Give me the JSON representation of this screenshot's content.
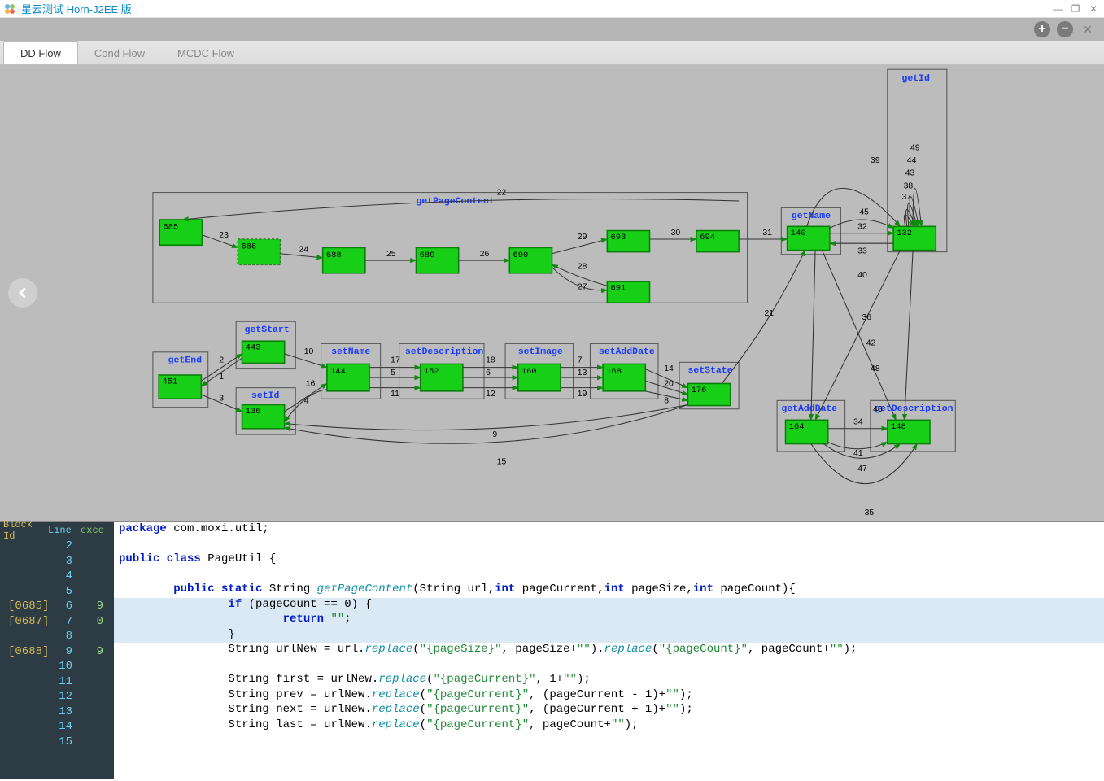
{
  "window": {
    "title": "星云测试 Horn-J2EE 版"
  },
  "tabs": {
    "dd": "DD Flow",
    "cond": "Cond Flow",
    "mcdc": "MCDC Flow",
    "active": "dd"
  },
  "groups": {
    "getPageContent": "getPageContent",
    "getId": "getId",
    "getName": "getName",
    "getEnd": "getEnd",
    "getStart": "getStart",
    "setId": "setId",
    "setName": "setName",
    "setDescription": "setDescription",
    "setImage": "setImage",
    "setAddDate": "setAddDate",
    "setState": "setState",
    "getAddDate": "getAddDate",
    "getDescription": "getDescription"
  },
  "nodes": {
    "n685": "685",
    "n686": "686",
    "n688": "688",
    "n689": "689",
    "n690": "690",
    "n691": "691",
    "n693": "693",
    "n694": "694",
    "n140": "140",
    "n132": "132",
    "n451": "451",
    "n443": "443",
    "n136": "136",
    "n144": "144",
    "n152": "152",
    "n160": "160",
    "n168": "168",
    "n176": "176",
    "n164": "164",
    "n148": "148"
  },
  "edges": {
    "e1": "1",
    "e2": "2",
    "e3": "3",
    "e4": "4",
    "e5": "5",
    "e6": "6",
    "e7": "7",
    "e8": "8",
    "e9": "9",
    "e10": "10",
    "e11": "11",
    "e12": "12",
    "e13": "13",
    "e14": "14",
    "e15": "15",
    "e16": "16",
    "e17": "17",
    "e18": "18",
    "e19": "19",
    "e20": "20",
    "e21": "21",
    "e22": "22",
    "e23": "23",
    "e24": "24",
    "e25": "25",
    "e26": "26",
    "e27": "27",
    "e28": "28",
    "e29": "29",
    "e30": "30",
    "e31": "31",
    "e32": "32",
    "e33": "33",
    "e34": "34",
    "e35": "35",
    "e36": "36",
    "e37": "37",
    "e38": "38",
    "e39": "39",
    "e40": "40",
    "e41": "41",
    "e42": "42",
    "e43": "43",
    "e44": "44",
    "e45": "45",
    "e46": "46",
    "e47": "47",
    "e48": "48",
    "e49": "49",
    "e42b": "42"
  },
  "gutter": {
    "h_block": "Block Id",
    "h_line": "Line",
    "h_exce": "exce",
    "rows": [
      {
        "block": "",
        "line": "2",
        "exc": ""
      },
      {
        "block": "",
        "line": "3",
        "exc": ""
      },
      {
        "block": "",
        "line": "4",
        "exc": ""
      },
      {
        "block": "",
        "line": "5",
        "exc": ""
      },
      {
        "block": "[0685]",
        "line": "6",
        "exc": "9"
      },
      {
        "block": "[0687]",
        "line": "7",
        "exc": "0"
      },
      {
        "block": "",
        "line": "8",
        "exc": ""
      },
      {
        "block": "[0688]",
        "line": "9",
        "exc": "9"
      },
      {
        "block": "",
        "line": "10",
        "exc": ""
      },
      {
        "block": "",
        "line": "11",
        "exc": ""
      },
      {
        "block": "",
        "line": "12",
        "exc": ""
      },
      {
        "block": "",
        "line": "13",
        "exc": ""
      },
      {
        "block": "",
        "line": "14",
        "exc": ""
      },
      {
        "block": "",
        "line": "15",
        "exc": ""
      }
    ]
  },
  "code": {
    "l1_a": "package",
    "l1_b": " com.moxi.util;",
    "l3_a": "public class",
    "l3_b": " PageUtil {",
    "l5_a": "        public static",
    "l5_b": " String ",
    "l5_c": "getPageContent",
    "l5_d": "(String url,",
    "l5_e": "int",
    "l5_f": " pageCurrent,",
    "l5_g": "int",
    "l5_h": " pageSize,",
    "l5_i": "int",
    "l5_j": " pageCount){",
    "l6_a": "                if",
    "l6_b": " (pageCount == 0) {",
    "l7_a": "                        return",
    "l7_b": " \"\"",
    "l7_c": ";",
    "l8": "                }",
    "l9_a": "                String urlNew = url.",
    "l9_b": "replace",
    "l9_c": "(",
    "l9_d": "\"{pageSize}\"",
    "l9_e": ", pageSize+",
    "l9_f": "\"\"",
    "l9_g": ").",
    "l9_h": "replace",
    "l9_i": "(",
    "l9_j": "\"{pageCount}\"",
    "l9_k": ", pageCount+",
    "l9_l": "\"\"",
    "l9_m": ");",
    "l11_a": "                String first = urlNew.",
    "l11_b": "replace",
    "l11_c": "(",
    "l11_d": "\"{pageCurrent}\"",
    "l11_e": ", 1+",
    "l11_f": "\"\"",
    "l11_g": ");",
    "l12_a": "                String prev = urlNew.",
    "l12_b": "replace",
    "l12_c": "(",
    "l12_d": "\"{pageCurrent}\"",
    "l12_e": ", (pageCurrent - 1)+",
    "l12_f": "\"\"",
    "l12_g": ");",
    "l13_a": "                String next = urlNew.",
    "l13_b": "replace",
    "l13_c": "(",
    "l13_d": "\"{pageCurrent}\"",
    "l13_e": ", (pageCurrent + 1)+",
    "l13_f": "\"\"",
    "l13_g": ");",
    "l14_a": "                String last = urlNew.",
    "l14_b": "replace",
    "l14_c": "(",
    "l14_d": "\"{pageCurrent}\"",
    "l14_e": ", pageCount+",
    "l14_f": "\"\"",
    "l14_g": ");"
  }
}
